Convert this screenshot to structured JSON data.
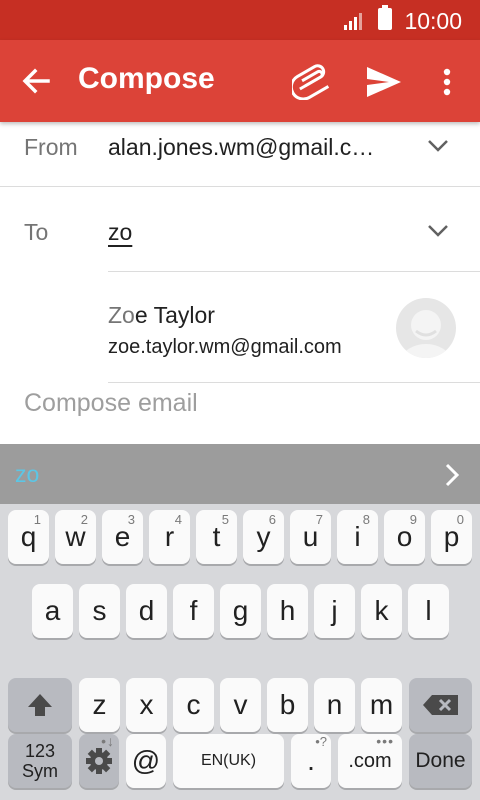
{
  "status": {
    "time": "10:00"
  },
  "appbar": {
    "title": "Compose"
  },
  "from": {
    "label": "From",
    "value": "alan.jones.wm@gmail.c…"
  },
  "to": {
    "label": "To",
    "value": "zo"
  },
  "suggestion": {
    "name_match": "Zo",
    "name_rest": "e Taylor",
    "email": "zoe.taylor.wm@gmail.com"
  },
  "compose": {
    "placeholder": "Compose email"
  },
  "prediction": {
    "word": "zo"
  },
  "keyboard": {
    "row1": [
      {
        "key": "q",
        "hint": "1"
      },
      {
        "key": "w",
        "hint": "2"
      },
      {
        "key": "e",
        "hint": "3"
      },
      {
        "key": "r",
        "hint": "4"
      },
      {
        "key": "t",
        "hint": "5"
      },
      {
        "key": "y",
        "hint": "6"
      },
      {
        "key": "u",
        "hint": "7"
      },
      {
        "key": "i",
        "hint": "8"
      },
      {
        "key": "o",
        "hint": "9"
      },
      {
        "key": "p",
        "hint": "0"
      }
    ],
    "row2": [
      "a",
      "s",
      "d",
      "f",
      "g",
      "h",
      "j",
      "k",
      "l"
    ],
    "row3": [
      "z",
      "x",
      "c",
      "v",
      "b",
      "n",
      "m"
    ],
    "sym_line1": "123",
    "sym_line2": "Sym",
    "at": "@",
    "space": "EN(UK)",
    "period": ".",
    "period_hint": "•?",
    "dotcom": ".com",
    "dotcom_hint": "•••",
    "done": "Done"
  },
  "colors": {
    "statusbar": "#c62f23",
    "appbar": "#dc4338",
    "prediction": "#5cc6e5"
  }
}
